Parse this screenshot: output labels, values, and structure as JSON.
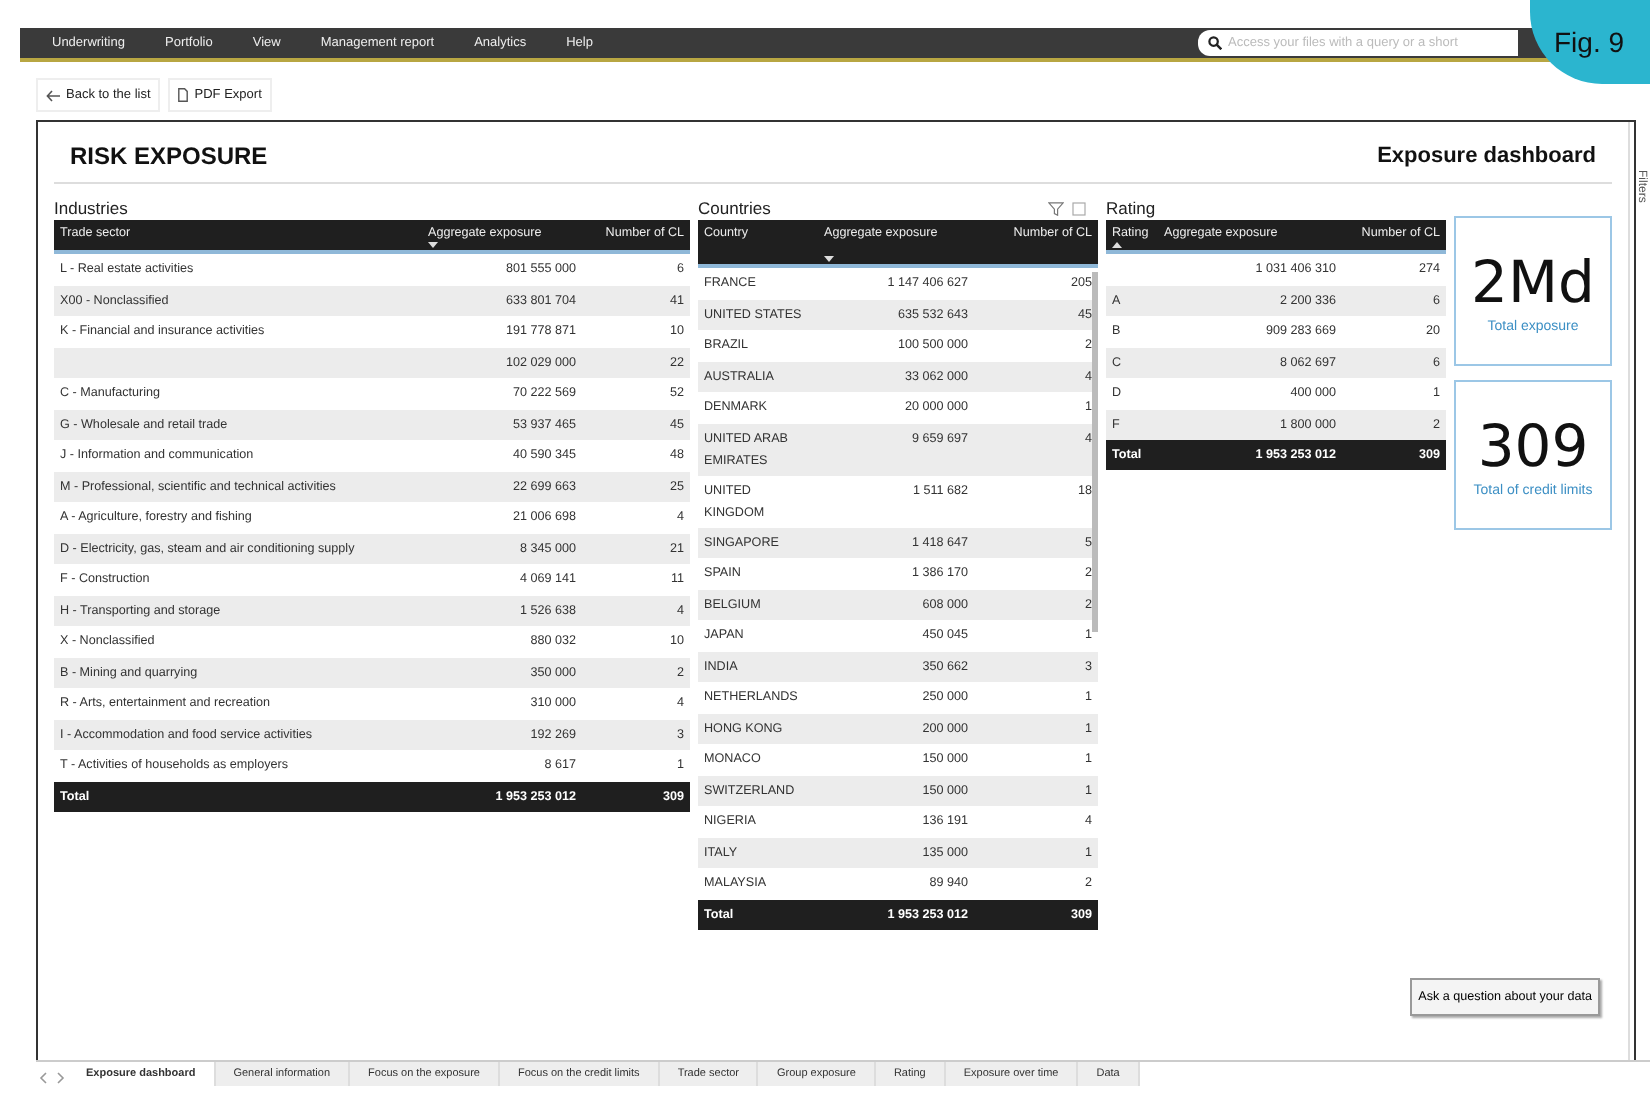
{
  "menu": [
    "Underwriting",
    "Portfolio",
    "View",
    "Management report",
    "Analytics",
    "Help"
  ],
  "search": {
    "placeholder": "Access your files with a query or a short"
  },
  "figure_label": "Fig. 9",
  "toolbar": [
    {
      "label": "Back to the list",
      "kind": "back"
    },
    {
      "label": "PDF Export",
      "kind": "pdf"
    }
  ],
  "report": {
    "title": "RISK EXPOSURE",
    "subtitle": "Exposure dashboard",
    "side_panel": "Filters"
  },
  "industries": {
    "title": "Industries",
    "columns": [
      {
        "label": "Trade sector",
        "sorted": false
      },
      {
        "label": "Aggregate exposure",
        "sorted": true,
        "ascending": false
      },
      {
        "label": "Number of CL",
        "sorted": false
      }
    ],
    "rows": [
      [
        "L - Real estate activities",
        "801 555 000",
        "6"
      ],
      [
        "X00 - Nonclassified",
        "633 801 704",
        "41"
      ],
      [
        "K - Financial and insurance activities",
        "191 778 871",
        "10"
      ],
      [
        "",
        "102 029 000",
        "22"
      ],
      [
        "C - Manufacturing",
        "70 222 569",
        "52"
      ],
      [
        "G - Wholesale and retail trade",
        "53 937 465",
        "45"
      ],
      [
        "J - Information and communication",
        "40 590 345",
        "48"
      ],
      [
        "M - Professional, scientific and technical activities",
        "22 699 663",
        "25"
      ],
      [
        "A - Agriculture, forestry and fishing",
        "21 006 698",
        "4"
      ],
      [
        "D - Electricity, gas, steam and air conditioning supply",
        "8 345 000",
        "21"
      ],
      [
        "F - Construction",
        "4 069 141",
        "11"
      ],
      [
        "H - Transporting and storage",
        "1 526 638",
        "4"
      ],
      [
        "X - Nonclassified",
        "880 032",
        "10"
      ],
      [
        "B - Mining and quarrying",
        "350 000",
        "2"
      ],
      [
        "R - Arts, entertainment and recreation",
        "310 000",
        "4"
      ],
      [
        "I - Accommodation and food service activities",
        "192 269",
        "3"
      ],
      [
        "T - Activities of households as employers",
        "8 617",
        "1"
      ]
    ],
    "total": [
      "Total",
      "1 953 253 012",
      "309"
    ]
  },
  "countries": {
    "title": "Countries",
    "columns": [
      {
        "label": "Country",
        "sorted": false
      },
      {
        "label": "Aggregate exposure",
        "sorted": true,
        "ascending": false
      },
      {
        "label": "Number of CL",
        "sorted": false
      }
    ],
    "rows": [
      [
        "FRANCE",
        "1 147 406 627",
        "205"
      ],
      [
        "UNITED STATES",
        "635 532 643",
        "45"
      ],
      [
        "BRAZIL",
        "100 500 000",
        "2"
      ],
      [
        "AUSTRALIA",
        "33 062 000",
        "4"
      ],
      [
        "DENMARK",
        "20 000 000",
        "1"
      ],
      [
        "UNITED ARAB EMIRATES",
        "9 659 697",
        "4"
      ],
      [
        "UNITED KINGDOM",
        "1 511 682",
        "18"
      ],
      [
        "SINGAPORE",
        "1 418 647",
        "5"
      ],
      [
        "SPAIN",
        "1 386 170",
        "2"
      ],
      [
        "BELGIUM",
        "608 000",
        "2"
      ],
      [
        "JAPAN",
        "450 045",
        "1"
      ],
      [
        "INDIA",
        "350 662",
        "3"
      ],
      [
        "NETHERLANDS",
        "250 000",
        "1"
      ],
      [
        "HONG KONG",
        "200 000",
        "1"
      ],
      [
        "MONACO",
        "150 000",
        "1"
      ],
      [
        "SWITZERLAND",
        "150 000",
        "1"
      ],
      [
        "NIGERIA",
        "136 191",
        "4"
      ],
      [
        "ITALY",
        "135 000",
        "1"
      ],
      [
        "MALAYSIA",
        "89 940",
        "2"
      ]
    ],
    "total": [
      "Total",
      "1 953 253 012",
      "309"
    ]
  },
  "rating": {
    "title": "Rating",
    "columns": [
      {
        "label": "Rating",
        "sorted": true,
        "ascending": true
      },
      {
        "label": "Aggregate exposure",
        "sorted": false
      },
      {
        "label": "Number of CL",
        "sorted": false
      }
    ],
    "rows": [
      [
        "",
        "1 031 406 310",
        "274"
      ],
      [
        "A",
        "2 200 336",
        "6"
      ],
      [
        "B",
        "909 283 669",
        "20"
      ],
      [
        "C",
        "8 062 697",
        "6"
      ],
      [
        "D",
        "400 000",
        "1"
      ],
      [
        "F",
        "1 800 000",
        "2"
      ]
    ],
    "total": [
      "Total",
      "1 953 253 012",
      "309"
    ]
  },
  "cards": [
    {
      "value": "2Md",
      "label": "Total exposure"
    },
    {
      "value": "309",
      "label": "Total of credit limits"
    }
  ],
  "ask_button": "Ask a question about your data",
  "page_tabs": [
    {
      "label": "Exposure dashboard",
      "selected": true
    },
    {
      "label": "General information",
      "selected": false
    },
    {
      "label": "Focus on the exposure",
      "selected": false
    },
    {
      "label": "Focus on the credit limits",
      "selected": false
    },
    {
      "label": "Trade sector",
      "selected": false
    },
    {
      "label": "Group exposure",
      "selected": false
    },
    {
      "label": "Rating",
      "selected": false
    },
    {
      "label": "Exposure over time",
      "selected": false
    },
    {
      "label": "Data",
      "selected": false
    }
  ]
}
